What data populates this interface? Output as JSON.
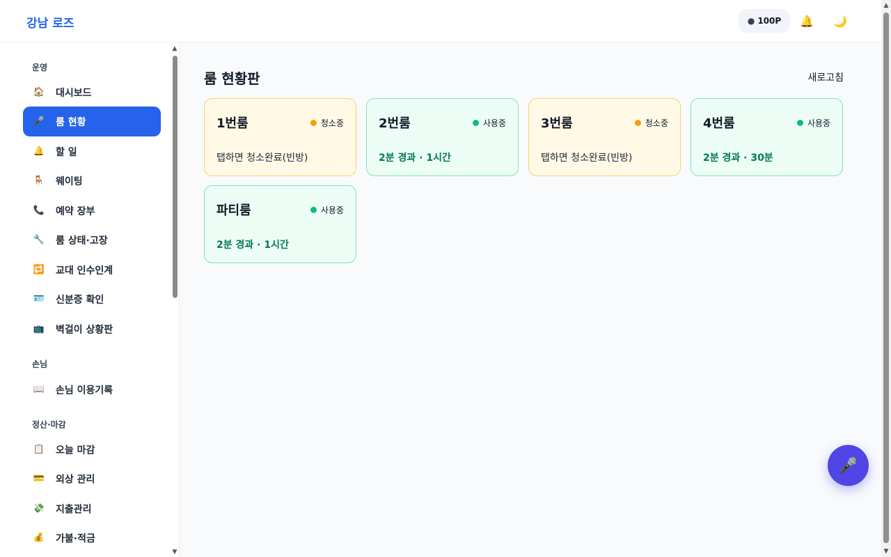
{
  "header": {
    "brand": "강남 로즈",
    "points": "100P",
    "points_icon": "robot-face-icon",
    "bell_icon": "🔔",
    "moon_icon": "🌙"
  },
  "sidebar": {
    "sections": [
      {
        "label": "운영",
        "items": [
          {
            "label": "대시보드",
            "icon": "🏠",
            "active": false
          },
          {
            "label": "룸 현황",
            "icon": "🎤",
            "active": true
          },
          {
            "label": "할 일",
            "icon": "🔔",
            "active": false
          },
          {
            "label": "웨이팅",
            "icon": "🪑",
            "active": false
          },
          {
            "label": "예약 장부",
            "icon": "📞",
            "active": false
          },
          {
            "label": "룸 상태·고장",
            "icon": "🔧",
            "active": false
          },
          {
            "label": "교대 인수인계",
            "icon": "🔁",
            "active": false
          },
          {
            "label": "신분증 확인",
            "icon": "🪪",
            "active": false
          },
          {
            "label": "벽걸이 상황판",
            "icon": "📺",
            "active": false
          }
        ]
      },
      {
        "label": "손님",
        "items": [
          {
            "label": "손님 이용기록",
            "icon": "📖",
            "active": false
          }
        ]
      },
      {
        "label": "정산·마감",
        "items": [
          {
            "label": "오늘 마감",
            "icon": "📋",
            "active": false
          },
          {
            "label": "외상 관리",
            "icon": "💳",
            "active": false
          },
          {
            "label": "지출관리",
            "icon": "💸",
            "active": false
          },
          {
            "label": "가불·적금",
            "icon": "💰",
            "active": false
          }
        ]
      }
    ]
  },
  "main": {
    "title": "룸 현황판",
    "refresh_label": "새로고침",
    "rooms": [
      {
        "name": "1번룸",
        "status": "청소중",
        "state": "cleaning",
        "info": "탭하면 청소완료(빈방)"
      },
      {
        "name": "2번룸",
        "status": "사용중",
        "state": "inuse",
        "info": "2분 경과 · 1시간"
      },
      {
        "name": "3번룸",
        "status": "청소중",
        "state": "cleaning",
        "info": "탭하면 청소완료(빈방)"
      },
      {
        "name": "4번룸",
        "status": "사용중",
        "state": "inuse",
        "info": "2분 경과 · 30분"
      },
      {
        "name": "파티룸",
        "status": "사용중",
        "state": "inuse",
        "info": "2분 경과 · 1시간"
      }
    ]
  },
  "fab": {
    "icon": "🎤",
    "icon_name": "microphone-icon"
  },
  "colors": {
    "brand": "#2563eb",
    "active_nav": "#2563eb",
    "cleaning_dot": "#f59e0b",
    "inuse_dot": "#10b981",
    "fab": "#4f46e5"
  }
}
